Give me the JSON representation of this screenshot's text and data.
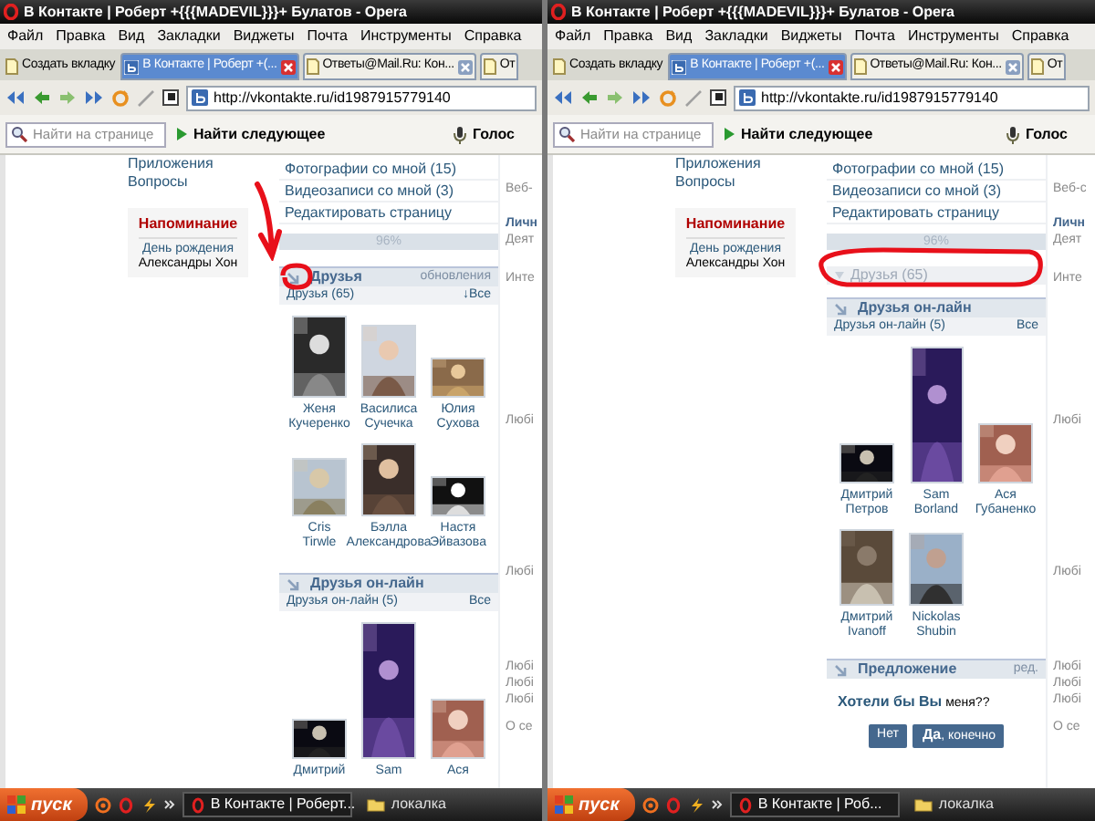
{
  "panels": [
    {
      "window": {
        "title": "В Контакте | Роберт +{{{MADEVIL}}}+ Булатов - Opera"
      },
      "menu": [
        "Файл",
        "Правка",
        "Вид",
        "Закладки",
        "Виджеты",
        "Почта",
        "Инструменты",
        "Справка"
      ],
      "new_tab": "Создать вкладку",
      "tabs": [
        {
          "label": "В Контакте | Роберт +(...",
          "selected": true
        },
        {
          "label": "Ответы@Mail.Ru: Кон...",
          "selected": false
        },
        {
          "label": "От",
          "selected": false
        }
      ],
      "address": "http://vkontakte.ru/id1987915779140",
      "find": {
        "placeholder": "Найти на странице",
        "next": "Найти следующее",
        "voice": "Голос"
      },
      "sidebar": [
        "Приложения",
        "Вопросы"
      ],
      "reminder": {
        "title": "Напоминание",
        "text": "День рождения",
        "name": "Александры Хон"
      },
      "links": [
        "Фотографии со мной (15)",
        "Видеозаписи со мной (3)",
        "Редактировать страницу"
      ],
      "rating": "96%",
      "friends": {
        "title": "Друзья",
        "action": "обновления",
        "count": "Друзья (65)",
        "all": "↓Все",
        "expanded": true,
        "people": [
          {
            "first": "Женя",
            "last": "Кучеренко"
          },
          {
            "first": "Василиса",
            "last": "Сучечка"
          },
          {
            "first": "Юлия",
            "last": "Сухова"
          },
          {
            "first": "Cris",
            "last": "Tirwle"
          },
          {
            "first": "Бэлла",
            "last": "Александрова"
          },
          {
            "first": "Настя",
            "last": "Эйвазова"
          }
        ]
      },
      "online": {
        "title": "Друзья он-лайн",
        "count": "Друзья он-лайн (5)",
        "all": "Все",
        "people": [
          {
            "first": "Дмитрий"
          },
          {
            "first": "Sam"
          },
          {
            "first": "Ася"
          }
        ]
      },
      "profile_labels": [
        {
          "text": "Веб-",
          "kind": "field"
        },
        {
          "text": "Личн",
          "kind": "heading"
        },
        {
          "text": "Деят",
          "kind": "field"
        },
        {
          "text": "Инте",
          "kind": "field"
        },
        {
          "text": "Любі",
          "kind": "field"
        },
        {
          "text": "Любі",
          "kind": "field"
        },
        {
          "text": "Любі",
          "kind": "field"
        },
        {
          "text": "Любі",
          "kind": "field"
        },
        {
          "text": "Любі",
          "kind": "field"
        },
        {
          "text": "О се",
          "kind": "field"
        }
      ],
      "annotation": {
        "kind": "arrow"
      },
      "taskbar": {
        "start": "пуск",
        "tasks": [
          {
            "label": "В Контакте | Роберт...",
            "selected": true
          },
          {
            "label": "локалка",
            "selected": false
          }
        ]
      }
    },
    {
      "window": {
        "title": "В Контакте | Роберт +{{{MADEVIL}}}+ Булатов - Opera"
      },
      "menu": [
        "Файл",
        "Правка",
        "Вид",
        "Закладки",
        "Виджеты",
        "Почта",
        "Инструменты",
        "Справка"
      ],
      "new_tab": "Создать вкладку",
      "tabs": [
        {
          "label": "В Контакте | Роберт +(...",
          "selected": true
        },
        {
          "label": "Ответы@Mail.Ru: Кон...",
          "selected": false
        },
        {
          "label": "От",
          "selected": false
        }
      ],
      "address": "http://vkontakte.ru/id1987915779140",
      "find": {
        "placeholder": "Найти на странице",
        "next": "Найти следующее",
        "voice": "Голос"
      },
      "sidebar": [
        "Приложения",
        "Вопросы"
      ],
      "reminder": {
        "title": "Напоминание",
        "text": "День рождения",
        "name": "Александры Хон"
      },
      "links": [
        "Фотографии со мной (15)",
        "Видеозаписи со мной (3)",
        "Редактировать страницу"
      ],
      "rating": "96%",
      "friends": {
        "title": "Друзья (65)",
        "expanded": false
      },
      "online": {
        "title": "Друзья он-лайн",
        "count": "Друзья он-лайн (5)",
        "all": "Все",
        "people": [
          {
            "first": "Дмитрий",
            "last": "Петров"
          },
          {
            "first": "Sam",
            "last": "Borland"
          },
          {
            "first": "Ася",
            "last": "Губаненко"
          },
          {
            "first": "Дмитрий",
            "last": "Ivanoff"
          },
          {
            "first": "Nickolas",
            "last": "Shubin"
          }
        ]
      },
      "offer": {
        "title": "Предложение",
        "action": "ред.",
        "question": "**Хотели бы Вы** меня??",
        "buttons": [
          "Нет",
          "**Да**, конечно"
        ]
      },
      "profile_labels": [
        {
          "text": "Веб-с",
          "kind": "field"
        },
        {
          "text": "Личн",
          "kind": "heading"
        },
        {
          "text": "Деят",
          "kind": "field"
        },
        {
          "text": "Инте",
          "kind": "field"
        },
        {
          "text": "Любі",
          "kind": "field"
        },
        {
          "text": "Любі",
          "kind": "field"
        },
        {
          "text": "Любі",
          "kind": "field"
        },
        {
          "text": "Любі",
          "kind": "field"
        },
        {
          "text": "Любі",
          "kind": "field"
        },
        {
          "text": "О се",
          "kind": "field"
        }
      ],
      "annotation": {
        "kind": "ellipse"
      },
      "taskbar": {
        "start": "пуск",
        "tasks": [
          {
            "label": "В Контакте | Роб...",
            "selected": true
          },
          {
            "label": "локалка",
            "selected": false
          }
        ]
      }
    }
  ]
}
